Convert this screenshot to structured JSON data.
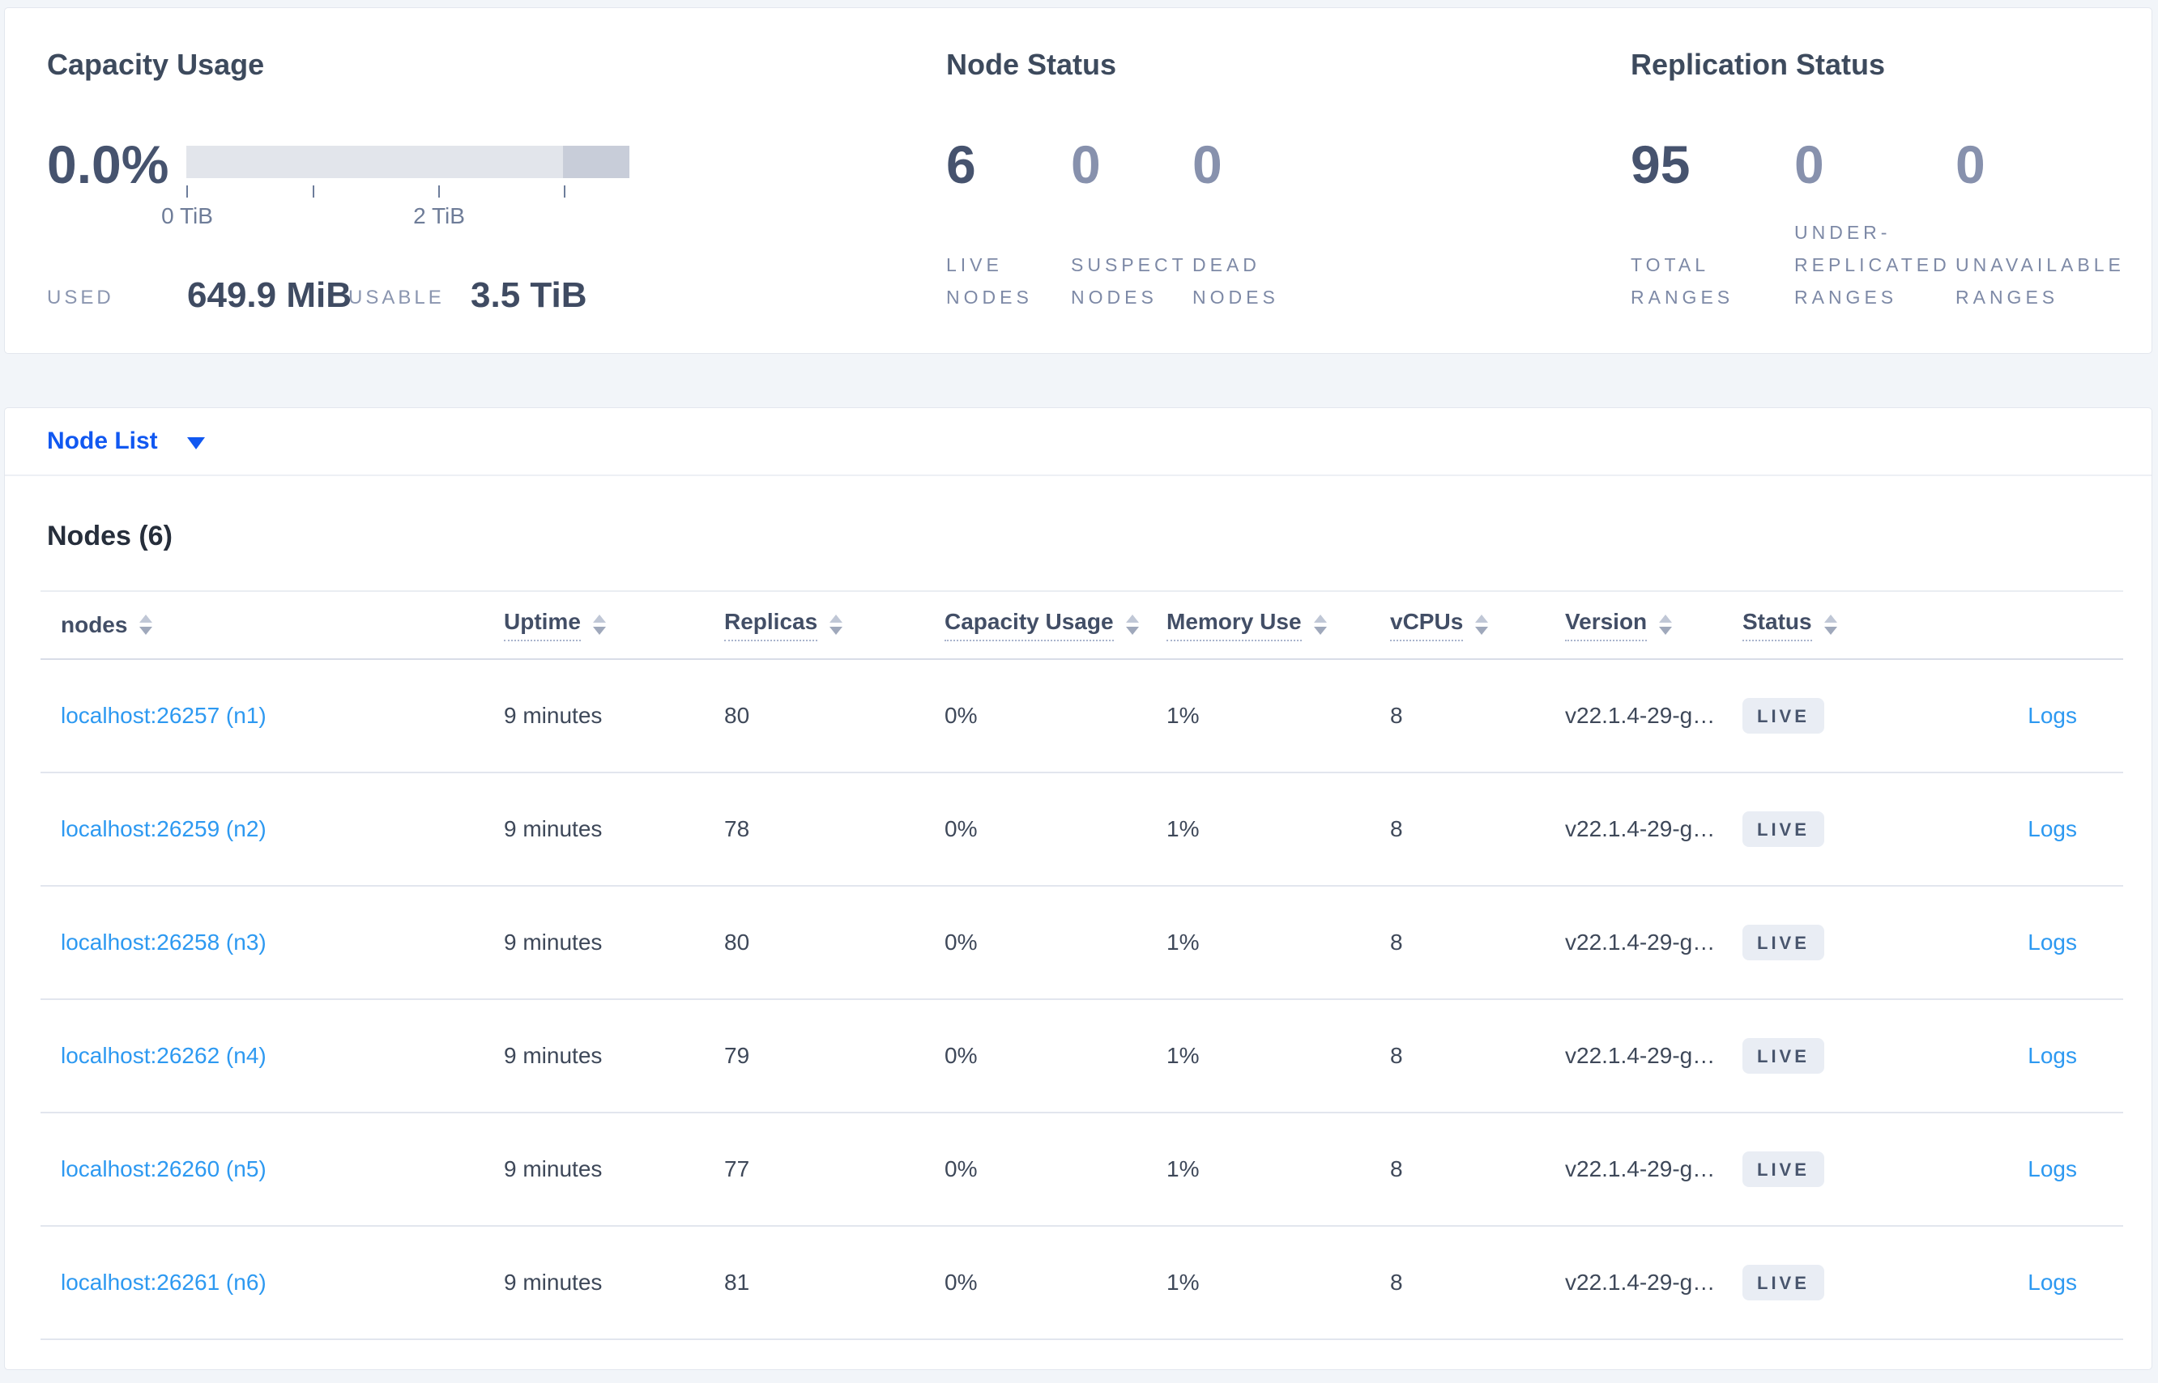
{
  "colors": {
    "page_background": "#f2f5f9",
    "card_background": "#ffffff",
    "primary_blue": "#1158f1",
    "link_blue": "#2d99f1",
    "dark_stat": "#46536e",
    "muted_stat": "#8791ad",
    "badge_background": "#e9edf4",
    "bar_light": "#e2e5eb",
    "bar_dark": "#c8cdd9"
  },
  "summary": {
    "capacity": {
      "title": "Capacity Usage",
      "percent_used": "0.0%",
      "axis_tick_labels": [
        "0 TiB",
        "",
        "2 TiB",
        ""
      ],
      "used_label": "USED",
      "used_value": "649.9 MiB",
      "usable_label": "USABLE",
      "usable_value": "3.5 TiB"
    },
    "node_status": {
      "title": "Node Status",
      "stats": [
        {
          "value": "6",
          "label": "LIVE NODES",
          "emphasized": true
        },
        {
          "value": "0",
          "label": "SUSPECT NODES",
          "emphasized": false
        },
        {
          "value": "0",
          "label": "DEAD NODES",
          "emphasized": false
        }
      ]
    },
    "replication_status": {
      "title": "Replication Status",
      "stats": [
        {
          "value": "95",
          "label": "TOTAL RANGES",
          "emphasized": true
        },
        {
          "value": "0",
          "label": "UNDER-REPLICATED RANGES",
          "emphasized": false
        },
        {
          "value": "0",
          "label": "UNAVAILABLE RANGES",
          "emphasized": false
        }
      ]
    }
  },
  "node_list": {
    "selector_label": "Node List",
    "panel_title": "Nodes (6)",
    "columns": [
      {
        "id": "node",
        "label": "nodes",
        "dotted": false
      },
      {
        "id": "uptime",
        "label": "Uptime",
        "dotted": true
      },
      {
        "id": "replicas",
        "label": "Replicas",
        "dotted": true
      },
      {
        "id": "capacity",
        "label": "Capacity Usage",
        "dotted": true
      },
      {
        "id": "memory",
        "label": "Memory Use",
        "dotted": true
      },
      {
        "id": "vcpus",
        "label": "vCPUs",
        "dotted": true
      },
      {
        "id": "version",
        "label": "Version",
        "dotted": true
      },
      {
        "id": "status",
        "label": "Status",
        "dotted": true
      }
    ],
    "logs_label": "Logs",
    "rows": [
      {
        "node": "localhost:26257 (n1)",
        "uptime": "9 minutes",
        "replicas": "80",
        "capacity": "0%",
        "memory": "1%",
        "vcpus": "8",
        "version": "v22.1.4-29-g…",
        "status": "LIVE"
      },
      {
        "node": "localhost:26259 (n2)",
        "uptime": "9 minutes",
        "replicas": "78",
        "capacity": "0%",
        "memory": "1%",
        "vcpus": "8",
        "version": "v22.1.4-29-g…",
        "status": "LIVE"
      },
      {
        "node": "localhost:26258 (n3)",
        "uptime": "9 minutes",
        "replicas": "80",
        "capacity": "0%",
        "memory": "1%",
        "vcpus": "8",
        "version": "v22.1.4-29-g…",
        "status": "LIVE"
      },
      {
        "node": "localhost:26262 (n4)",
        "uptime": "9 minutes",
        "replicas": "79",
        "capacity": "0%",
        "memory": "1%",
        "vcpus": "8",
        "version": "v22.1.4-29-g…",
        "status": "LIVE"
      },
      {
        "node": "localhost:26260 (n5)",
        "uptime": "9 minutes",
        "replicas": "77",
        "capacity": "0%",
        "memory": "1%",
        "vcpus": "8",
        "version": "v22.1.4-29-g…",
        "status": "LIVE"
      },
      {
        "node": "localhost:26261 (n6)",
        "uptime": "9 minutes",
        "replicas": "81",
        "capacity": "0%",
        "memory": "1%",
        "vcpus": "8",
        "version": "v22.1.4-29-g…",
        "status": "LIVE"
      }
    ]
  }
}
